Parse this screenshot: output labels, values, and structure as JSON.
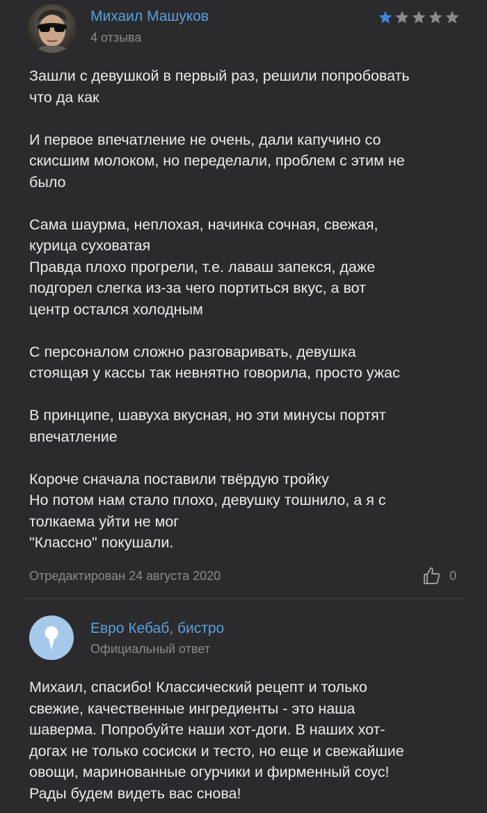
{
  "review": {
    "author": {
      "name": "Михаил Машуков",
      "reviews_count": "4 отзыва",
      "avatar_icon": "user-photo-sunglasses"
    },
    "rating": {
      "value": 1,
      "max": 5,
      "filled_color": "#3d87d6",
      "empty_color": "#8b8b8e"
    },
    "paragraphs": [
      "Зашли с девушкой в первый раз, решили попробовать\nчто да как",
      "И первое впечатление не очень, дали капучино со\nскисшим молоком, но переделали, проблем с этим не\nбыло",
      "Сама шаурма, неплохая, начинка сочная, свежая,\nкурица суховатая\nПравда плохо прогрели, т.е. лаваш запекся, даже\nподгорел слегка из-за чего портиться вкус, а вот\nцентр остался холодным",
      "С персоналом сложно разговаривать, девушка\nстоящая у кассы так невнятно говорила, просто ужас",
      "В принципе, шавуха вкусная, но эти минусы портят\nвпечатление",
      "Короче сначала поставили твёрдую тройку\nНо потом нам стало плохо, девушку тошнило, а я с\nтолкаема уйти не мог\n\"Классно\" покушали."
    ],
    "edited_label": "Отредактирован 24 августа 2020",
    "likes": {
      "icon": "thumbs-up-icon",
      "count": "0"
    }
  },
  "reply": {
    "business_name": "Евро Кебаб, бистро",
    "label": "Официальный ответ",
    "avatar_icon": "map-pin-icon",
    "avatar_color": "#a6c8ea",
    "text": "Михаил, спасибо! Классический рецепт и только\nсвежие, качественные ингредиенты - это наша\nшаверма. Попробуйте наши хот-доги. В наших хот-\nдогах не только сосиски и тесто, но еще и свежайшие\nовощи, маринованные огурчики и фирменный соус!\nРады будем видеть вас снова!"
  }
}
